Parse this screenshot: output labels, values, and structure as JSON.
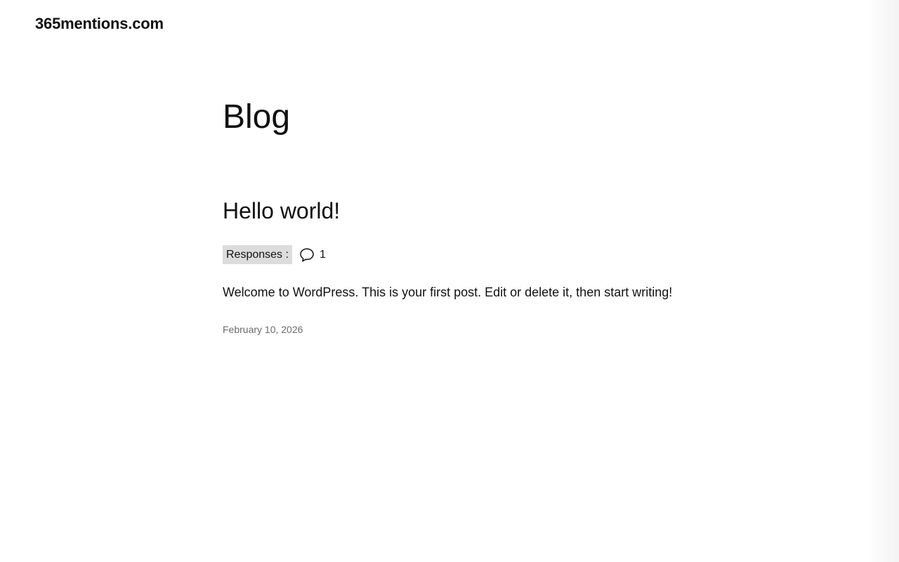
{
  "site": {
    "title": "365mentions.com"
  },
  "page": {
    "heading": "Blog"
  },
  "post": {
    "title": "Hello world!",
    "responses_label": "Responses :",
    "comment_icon": "speech-bubble-icon",
    "comment_count": "1",
    "excerpt": "Welcome to WordPress. This is your first post. Edit or delete it, then start writing!",
    "date": "February 10, 2026"
  },
  "colors": {
    "text": "#111111",
    "label_background": "#dcdcdc",
    "date_text": "#6b6b6b",
    "background": "#ffffff"
  }
}
